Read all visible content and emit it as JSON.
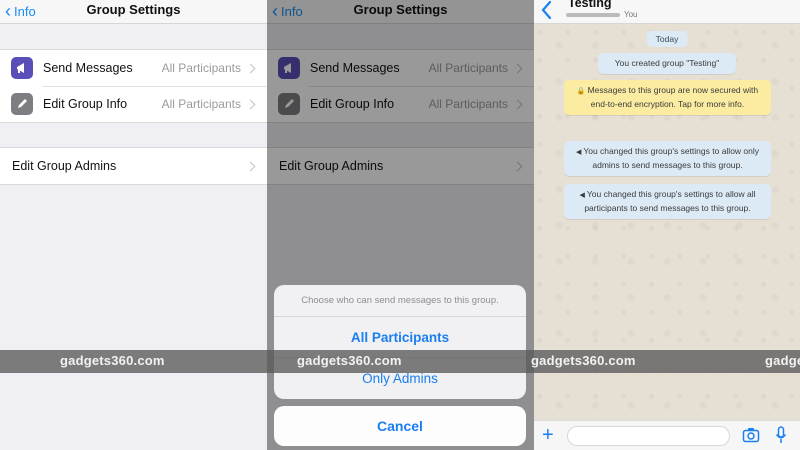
{
  "panel1": {
    "nav": {
      "back": "Info",
      "title": "Group Settings"
    },
    "rows": [
      {
        "label": "Send Messages",
        "value": "All Participants",
        "icon": "megaphone-icon"
      },
      {
        "label": "Edit Group Info",
        "value": "All Participants",
        "icon": "pencil-icon"
      }
    ],
    "admins": {
      "label": "Edit Group Admins"
    }
  },
  "panel2": {
    "nav": {
      "back": "Info",
      "title": "Group Settings"
    },
    "rows": [
      {
        "label": "Send Messages",
        "value": "All Participants"
      },
      {
        "label": "Edit Group Info",
        "value": "All Participants"
      }
    ],
    "admins": {
      "label": "Edit Group Admins"
    },
    "sheet": {
      "message": "Choose who can send messages to this group.",
      "options": [
        "All Participants",
        "Only Admins"
      ],
      "cancel": "Cancel"
    }
  },
  "panel3": {
    "header": {
      "title": "Testing",
      "subtitle": "You"
    },
    "date": "Today",
    "messages": [
      {
        "text": "You created group \"Testing\"",
        "style": "blue"
      },
      {
        "text": "Messages to this group are now secured with end-to-end encryption. Tap for more info.",
        "style": "yellow",
        "icon": "lock-icon"
      },
      {
        "text": "You changed this group's settings to allow only admins to send messages to this group.",
        "style": "blue",
        "icon": "megaphone-icon"
      },
      {
        "text": "You changed this group's settings to allow all participants to send messages to this group.",
        "style": "blue",
        "icon": "megaphone-icon"
      }
    ]
  },
  "watermark": [
    "gadgets360.com",
    "gadgets360.com",
    "gadgets360.com",
    "gadge"
  ],
  "colors": {
    "accent": "#1a7ff0",
    "icon_purple": "#5a4fb8",
    "system_blue": "#dceaf6",
    "system_yellow": "#fbeca2"
  }
}
